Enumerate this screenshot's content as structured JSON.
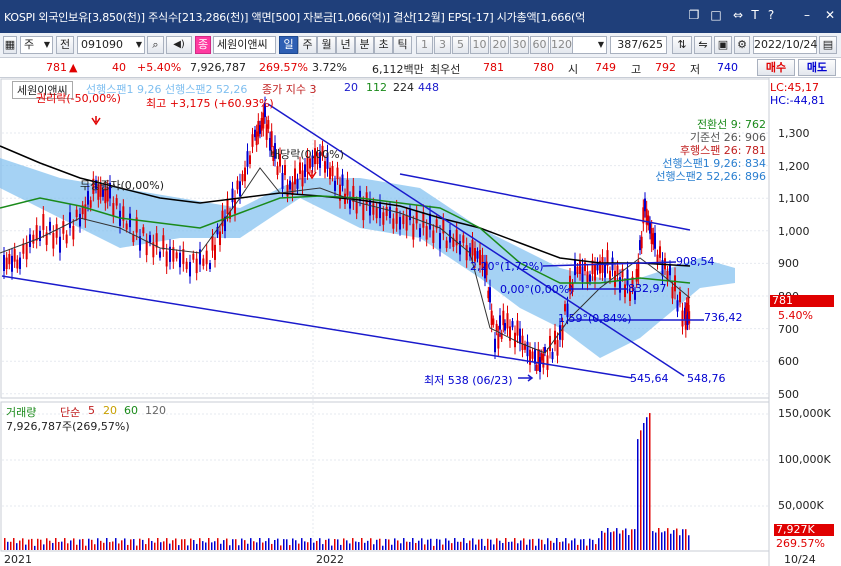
{
  "titlebar": {
    "text": "KOSPI 외국인보유[3,850(천)] 주식수[213,286(천)] 액면[500] 자본금[1,066(억)] 결산[12월] EPS[-17] 시가총액[1,666(억",
    "icons": [
      "restore-icon",
      "maximize-icon",
      "link-icon",
      "text-icon",
      "help-icon",
      "minimize-icon",
      "close-icon"
    ]
  },
  "toolbar": {
    "market_select": "주",
    "prefix": "전",
    "code": "091090",
    "flag": "종",
    "name": "세원이앤씨",
    "periods": [
      "일",
      "주",
      "월",
      "년",
      "분",
      "초",
      "틱"
    ],
    "active_period": "일",
    "intervals": [
      "1",
      "3",
      "5",
      "10",
      "20",
      "30",
      "60",
      "120"
    ],
    "page": "387/625",
    "date": "2022/10/24"
  },
  "quote": {
    "price": "781",
    "arrow": "▲",
    "change": "40",
    "change_pct": "+5.40%",
    "volume": "7,926,787",
    "volume_pct": "269.57%",
    "turnover": "3.72%",
    "amount": "6,112백만",
    "best_label": "최우선",
    "bid": "781",
    "ask": "780",
    "open_label": "시",
    "open": "749",
    "high_label": "고",
    "high": "792",
    "low_label": "저",
    "low": "740",
    "buy_label": "매수",
    "sell_label": "매도"
  },
  "chart": {
    "stock_label": "세원이앤씨",
    "legend_top": "선행스팬1 9,26  선행스팬2 52,26",
    "price_label": "종가 지수 3",
    "ma_values": [
      "20",
      "112",
      "224",
      "448"
    ],
    "lc": "LC:45,17",
    "hc": "HC:-44,81",
    "ichimoku": [
      {
        "label": "전환선 9: 762",
        "color": "#1a8a1a"
      },
      {
        "label": "기준선 26: 906",
        "color": "#555555"
      },
      {
        "label": "후행스팬 26: 781",
        "color": "#c02020"
      },
      {
        "label": "선행스팬1 9,26: 834",
        "color": "#2a7fd0"
      },
      {
        "label": "선행스팬2 52,26: 896",
        "color": "#2a7fd0"
      }
    ],
    "annotations": {
      "max": "최고 +3,175 (+60.93%)",
      "rights_drop": "권리락(-50,00%)",
      "free_issue": "무상증자(0,00%)",
      "dividend": "배당락(0,00%)",
      "min": "최저 538 (06/23)",
      "t1": "2,20°(1,72%)",
      "t2": "0,00°(0,00%)",
      "t3": "1,59°(0,84%)",
      "l1": "908,54",
      "l2": "832,97",
      "l3": "736,42",
      "l4": "545,64",
      "l5": "548,76"
    },
    "price_axis": [
      "1,300",
      "1,200",
      "1,100",
      "1,000",
      "900",
      "800",
      "700",
      "600",
      "500"
    ],
    "current_price_tag": "781",
    "current_pct_tag": "5.40%",
    "volume_label": "거래량",
    "volume_ma_label": "단순",
    "volume_ma": [
      "5",
      "20",
      "60",
      "120"
    ],
    "volume_value": "7,926,787주(269,57%)",
    "volume_axis": [
      "150,000K",
      "100,000K",
      "50,000K"
    ],
    "current_volume_tag": "7,927K",
    "current_volume_pct": "269.57%",
    "x_labels": [
      "2021",
      "2022"
    ],
    "date_tag": "10/24"
  },
  "colors": {
    "up": "#e00000",
    "down": "#0000d0",
    "accent": "#1f3f7a",
    "trend": "#1a1acc",
    "cloud": "#7fbff0"
  }
}
